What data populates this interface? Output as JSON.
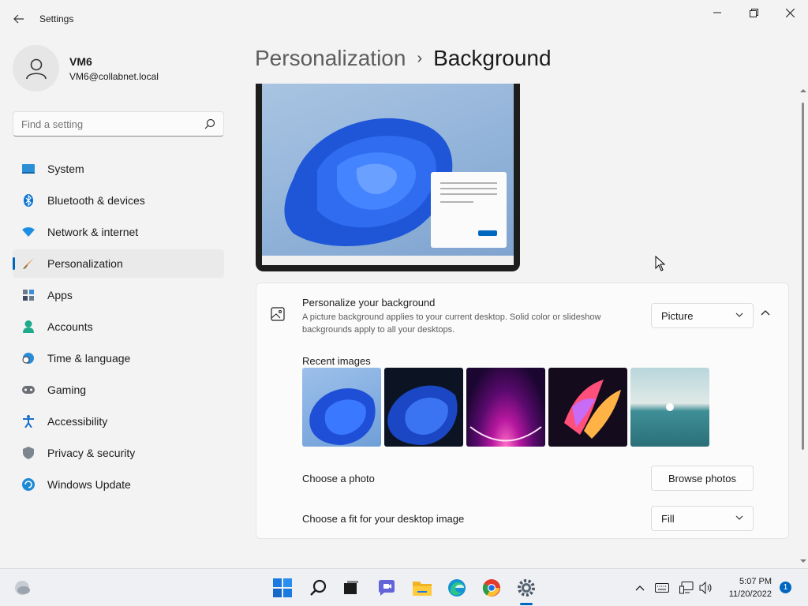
{
  "window": {
    "title": "Settings",
    "back_icon": "back-arrow-icon",
    "controls": [
      "minimize-icon",
      "restore-icon",
      "close-icon"
    ]
  },
  "profile": {
    "name": "VM6",
    "email": "VM6@collabnet.local"
  },
  "search": {
    "placeholder": "Find a setting"
  },
  "sidebar": {
    "items": [
      {
        "label": "System",
        "icon": "system-icon"
      },
      {
        "label": "Bluetooth & devices",
        "icon": "bluetooth-icon"
      },
      {
        "label": "Network & internet",
        "icon": "wifi-icon"
      },
      {
        "label": "Personalization",
        "icon": "brush-icon",
        "active": true
      },
      {
        "label": "Apps",
        "icon": "apps-icon"
      },
      {
        "label": "Accounts",
        "icon": "person-icon"
      },
      {
        "label": "Time & language",
        "icon": "clock-globe-icon"
      },
      {
        "label": "Gaming",
        "icon": "gamepad-icon"
      },
      {
        "label": "Accessibility",
        "icon": "accessibility-icon"
      },
      {
        "label": "Privacy & security",
        "icon": "shield-icon"
      },
      {
        "label": "Windows Update",
        "icon": "update-icon"
      }
    ]
  },
  "breadcrumb": {
    "parent": "Personalization",
    "separator": "›",
    "current": "Background"
  },
  "background_card": {
    "title": "Personalize your background",
    "description": "A picture background applies to your current desktop. Solid color or slideshow backgrounds apply to all your desktops.",
    "type_value": "Picture"
  },
  "recent_images": {
    "label": "Recent images",
    "images": [
      "bloom-light-thumbnail",
      "bloom-dark-thumbnail",
      "glow-purple-thumbnail",
      "ribbons-colorful-thumbnail",
      "lake-sunrise-thumbnail"
    ]
  },
  "choose_photo": {
    "label": "Choose a photo",
    "button": "Browse photos"
  },
  "fit": {
    "label": "Choose a fit for your desktop image",
    "value": "Fill"
  },
  "taskbar": {
    "apps": [
      "start-icon",
      "search-icon",
      "task-view-icon",
      "chat-icon",
      "file-explorer-icon",
      "edge-icon",
      "chrome-icon",
      "settings-icon"
    ],
    "tray": [
      "chevron-up-icon",
      "keyboard-icon",
      "network-icon",
      "volume-icon"
    ],
    "time": "5:07 PM",
    "date": "11/20/2022",
    "notifications": "1"
  },
  "colors": {
    "accent": "#0067c0",
    "background": "#f3f3f3",
    "card": "#fbfbfb"
  }
}
